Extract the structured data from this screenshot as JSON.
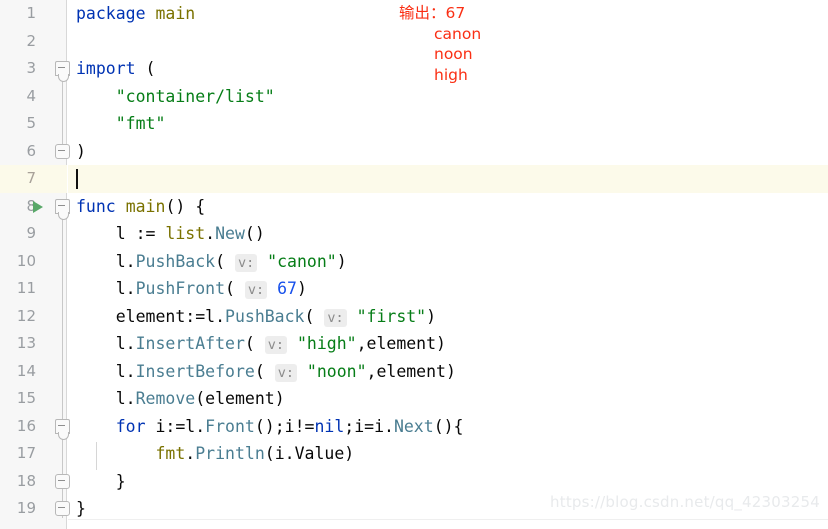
{
  "editor": {
    "language": "go",
    "total_lines": 19,
    "current_line": 7,
    "run_marker_line": 8,
    "colors": {
      "keyword": "#0033b3",
      "package": "#7a7200",
      "string": "#067d17",
      "function": "#4a7d91",
      "number": "#1750eb",
      "plain": "#080808",
      "hint_text": "#8c8c8c",
      "hint_background": "#ededed",
      "gutter_background": "#f7f7f7",
      "line_number": "#999da1",
      "current_line_background": "#fcfaea",
      "run_triangle": "#59a869",
      "annotation": "#fa2f14",
      "watermark": "#e8eaec"
    },
    "lines": [
      {
        "number": "1",
        "tokens": [
          {
            "t": "package",
            "c": "kw"
          },
          {
            "t": " ",
            "c": "pl"
          },
          {
            "t": "main",
            "c": "pkg"
          }
        ]
      },
      {
        "number": "2",
        "tokens": []
      },
      {
        "number": "3",
        "tokens": [
          {
            "t": "import",
            "c": "kw"
          },
          {
            "t": " (",
            "c": "pl"
          }
        ]
      },
      {
        "number": "4",
        "tokens": [
          {
            "t": "    ",
            "c": "pl"
          },
          {
            "t": "\"container/list\"",
            "c": "str"
          }
        ]
      },
      {
        "number": "5",
        "tokens": [
          {
            "t": "    ",
            "c": "pl"
          },
          {
            "t": "\"fmt\"",
            "c": "str"
          }
        ]
      },
      {
        "number": "6",
        "tokens": [
          {
            "t": ")",
            "c": "pl"
          }
        ]
      },
      {
        "number": "7",
        "tokens": []
      },
      {
        "number": "8",
        "tokens": [
          {
            "t": "func",
            "c": "kw"
          },
          {
            "t": " ",
            "c": "pl"
          },
          {
            "t": "main",
            "c": "pkg"
          },
          {
            "t": "() {",
            "c": "pl"
          }
        ]
      },
      {
        "number": "9",
        "tokens": [
          {
            "t": "    l := ",
            "c": "pl"
          },
          {
            "t": "list",
            "c": "pkg"
          },
          {
            "t": ".",
            "c": "pl"
          },
          {
            "t": "New",
            "c": "fn"
          },
          {
            "t": "()",
            "c": "pl"
          }
        ]
      },
      {
        "number": "10",
        "tokens": [
          {
            "t": "    l.",
            "c": "pl"
          },
          {
            "t": "PushBack",
            "c": "fn"
          },
          {
            "t": "( ",
            "c": "pl"
          },
          {
            "t": "v:",
            "c": "hint"
          },
          {
            "t": " ",
            "c": "pl"
          },
          {
            "t": "\"canon\"",
            "c": "str"
          },
          {
            "t": ")",
            "c": "pl"
          }
        ]
      },
      {
        "number": "11",
        "tokens": [
          {
            "t": "    l.",
            "c": "pl"
          },
          {
            "t": "PushFront",
            "c": "fn"
          },
          {
            "t": "( ",
            "c": "pl"
          },
          {
            "t": "v:",
            "c": "hint"
          },
          {
            "t": " ",
            "c": "pl"
          },
          {
            "t": "67",
            "c": "num"
          },
          {
            "t": ")",
            "c": "pl"
          }
        ]
      },
      {
        "number": "12",
        "tokens": [
          {
            "t": "    element:=l.",
            "c": "pl"
          },
          {
            "t": "PushBack",
            "c": "fn"
          },
          {
            "t": "( ",
            "c": "pl"
          },
          {
            "t": "v:",
            "c": "hint"
          },
          {
            "t": " ",
            "c": "pl"
          },
          {
            "t": "\"first\"",
            "c": "str"
          },
          {
            "t": ")",
            "c": "pl"
          }
        ]
      },
      {
        "number": "13",
        "tokens": [
          {
            "t": "    l.",
            "c": "pl"
          },
          {
            "t": "InsertAfter",
            "c": "fn"
          },
          {
            "t": "( ",
            "c": "pl"
          },
          {
            "t": "v:",
            "c": "hint"
          },
          {
            "t": " ",
            "c": "pl"
          },
          {
            "t": "\"high\"",
            "c": "str"
          },
          {
            "t": ",element)",
            "c": "pl"
          }
        ]
      },
      {
        "number": "14",
        "tokens": [
          {
            "t": "    l.",
            "c": "pl"
          },
          {
            "t": "InsertBefore",
            "c": "fn"
          },
          {
            "t": "( ",
            "c": "pl"
          },
          {
            "t": "v:",
            "c": "hint"
          },
          {
            "t": " ",
            "c": "pl"
          },
          {
            "t": "\"noon\"",
            "c": "str"
          },
          {
            "t": ",element)",
            "c": "pl"
          }
        ]
      },
      {
        "number": "15",
        "tokens": [
          {
            "t": "    l.",
            "c": "pl"
          },
          {
            "t": "Remove",
            "c": "fn"
          },
          {
            "t": "(element)",
            "c": "pl"
          }
        ]
      },
      {
        "number": "16",
        "tokens": [
          {
            "t": "    ",
            "c": "pl"
          },
          {
            "t": "for",
            "c": "kw"
          },
          {
            "t": " i:=l.",
            "c": "pl"
          },
          {
            "t": "Front",
            "c": "fn"
          },
          {
            "t": "();i!=",
            "c": "pl"
          },
          {
            "t": "nil",
            "c": "kw"
          },
          {
            "t": ";i=i.",
            "c": "pl"
          },
          {
            "t": "Next",
            "c": "fn"
          },
          {
            "t": "(){",
            "c": "pl"
          }
        ]
      },
      {
        "number": "17",
        "tokens": [
          {
            "t": "        ",
            "c": "pl"
          },
          {
            "t": "fmt",
            "c": "pkg"
          },
          {
            "t": ".",
            "c": "pl"
          },
          {
            "t": "Println",
            "c": "fn"
          },
          {
            "t": "(i.Value)",
            "c": "pl"
          }
        ]
      },
      {
        "number": "18",
        "tokens": [
          {
            "t": "    }",
            "c": "pl"
          }
        ]
      },
      {
        "number": "19",
        "tokens": [
          {
            "t": "}",
            "c": "pl"
          }
        ]
      }
    ]
  },
  "annotation": {
    "label": "输出：",
    "values": [
      "67",
      "canon",
      "noon",
      "high"
    ]
  },
  "watermark": {
    "text": "https://blog.csdn.net/qq_42303254"
  }
}
